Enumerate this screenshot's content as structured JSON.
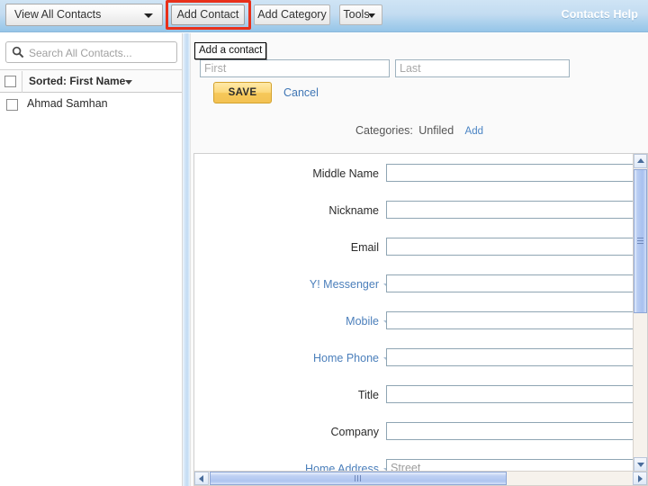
{
  "toolbar": {
    "view_select_label": "View All Contacts",
    "add_contact_label": "Add Contact",
    "add_category_label": "Add Category",
    "tools_label": "Tools",
    "help_label": "Contacts Help",
    "highlight_color": "#e8301a",
    "accent_color": "#96c5e8"
  },
  "sidebar": {
    "search_placeholder": "Search All Contacts...",
    "sorted_label": "Sorted: First Name",
    "contacts": [
      {
        "name": "Ahmad Samhan",
        "checked": false
      }
    ]
  },
  "tooltip": {
    "text": "Add a contact"
  },
  "name_form": {
    "first_placeholder": "First",
    "first_value": "",
    "last_placeholder": "Last",
    "last_value": "",
    "save_label": "SAVE",
    "cancel_label": "Cancel"
  },
  "categories": {
    "label": "Categories:",
    "value": "Unfiled",
    "add_label": "Add"
  },
  "fields": [
    {
      "label": "Middle Name",
      "value": "",
      "placeholder": "",
      "is_dropdown": false
    },
    {
      "label": "Nickname",
      "value": "",
      "placeholder": "",
      "is_dropdown": false
    },
    {
      "label": "Email",
      "value": "",
      "placeholder": "",
      "is_dropdown": false
    },
    {
      "label": "Y! Messenger",
      "value": "",
      "placeholder": "",
      "is_dropdown": true
    },
    {
      "label": "Mobile",
      "value": "",
      "placeholder": "",
      "is_dropdown": true
    },
    {
      "label": "Home Phone",
      "value": "",
      "placeholder": "",
      "is_dropdown": true
    },
    {
      "label": "Title",
      "value": "",
      "placeholder": "",
      "is_dropdown": false
    },
    {
      "label": "Company",
      "value": "",
      "placeholder": "",
      "is_dropdown": false
    },
    {
      "label": "Home Address",
      "value": "",
      "placeholder": "Street",
      "is_dropdown": true
    }
  ],
  "scrollbars": {
    "vertical_thumb_percent": 45,
    "horizontal_thumb_percent": 70
  }
}
